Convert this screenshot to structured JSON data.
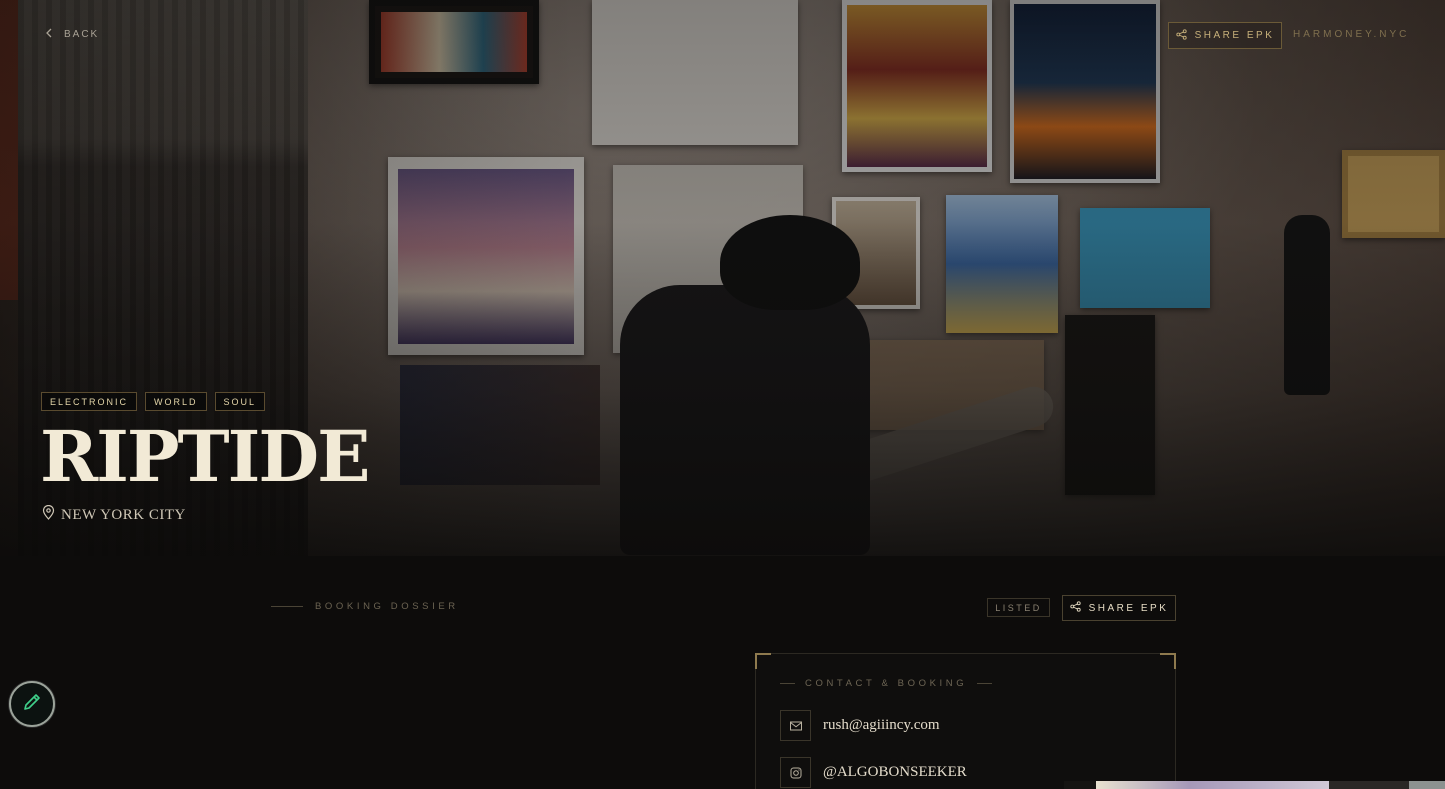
{
  "nav": {
    "back_label": "BACK",
    "share_label": "SHARE EPK",
    "site_label": "HARMONEY.NYC"
  },
  "artist": {
    "name": "RIPTIDE",
    "location": "NEW YORK CITY",
    "genres": [
      "ELECTRONIC",
      "WORLD",
      "SOUL"
    ]
  },
  "dossier": {
    "label": "BOOKING DOSSIER",
    "status_badge": "LISTED",
    "share_label": "SHARE EPK"
  },
  "contact": {
    "title": "CONTACT & BOOKING",
    "email": "rush@agiiincy.com",
    "instagram": "@ALGOBONSEEKER"
  },
  "icons": {
    "back": "chevron-left-icon",
    "share": "share-icon",
    "location": "map-pin-icon",
    "email": "mail-icon",
    "instagram": "instagram-icon",
    "edit": "pencil-icon"
  },
  "colors": {
    "accent_gold": "#c7b07a",
    "background": "#0d0c0b",
    "edit_green": "#3fd08a"
  }
}
